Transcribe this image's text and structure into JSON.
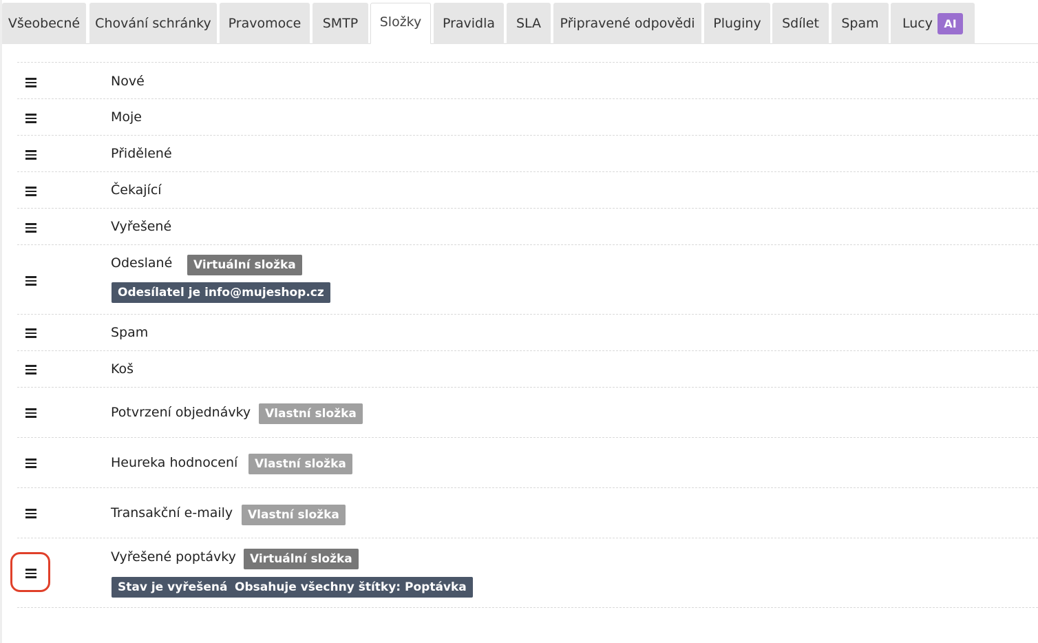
{
  "tabs": [
    {
      "label": "Všeobecné"
    },
    {
      "label": "Chování schránky"
    },
    {
      "label": "Pravomoce"
    },
    {
      "label": "SMTP"
    },
    {
      "label": "Složky",
      "active": true
    },
    {
      "label": "Pravidla"
    },
    {
      "label": "SLA"
    },
    {
      "label": "Připravené odpovědi"
    },
    {
      "label": "Pluginy"
    },
    {
      "label": "Sdílet"
    },
    {
      "label": "Spam"
    },
    {
      "label": "Lucy",
      "badge": "AI"
    }
  ],
  "folders": [
    {
      "name": "Nové"
    },
    {
      "name": "Moje"
    },
    {
      "name": "Přidělené"
    },
    {
      "name": "Čekající"
    },
    {
      "name": "Vyřešené"
    },
    {
      "name": "Odeslané",
      "type_badge": "Virtuální složka",
      "conditions": [
        "Odesílatel je info@mujeshop.cz"
      ]
    },
    {
      "name": "Spam"
    },
    {
      "name": "Koš"
    },
    {
      "name": "Potvrzení objednávky",
      "type_badge": "Vlastní složka"
    },
    {
      "name": "Heureka hodnocení",
      "type_badge": "Vlastní složka"
    },
    {
      "name": "Transakční e-maily",
      "type_badge": "Vlastní složka"
    },
    {
      "name": "Vyřešené poptávky",
      "type_badge": "Virtuální složka",
      "conditions": [
        "Stav je vyřešená",
        "Obsahuje všechny štítky: Poptávka"
      ]
    }
  ],
  "colors": {
    "virtual_badge": "#777777",
    "custom_badge": "#a0a0a0",
    "condition_badge": "#4a5668",
    "ai_badge": "#9a6fcf",
    "highlight": "#e0402a"
  }
}
